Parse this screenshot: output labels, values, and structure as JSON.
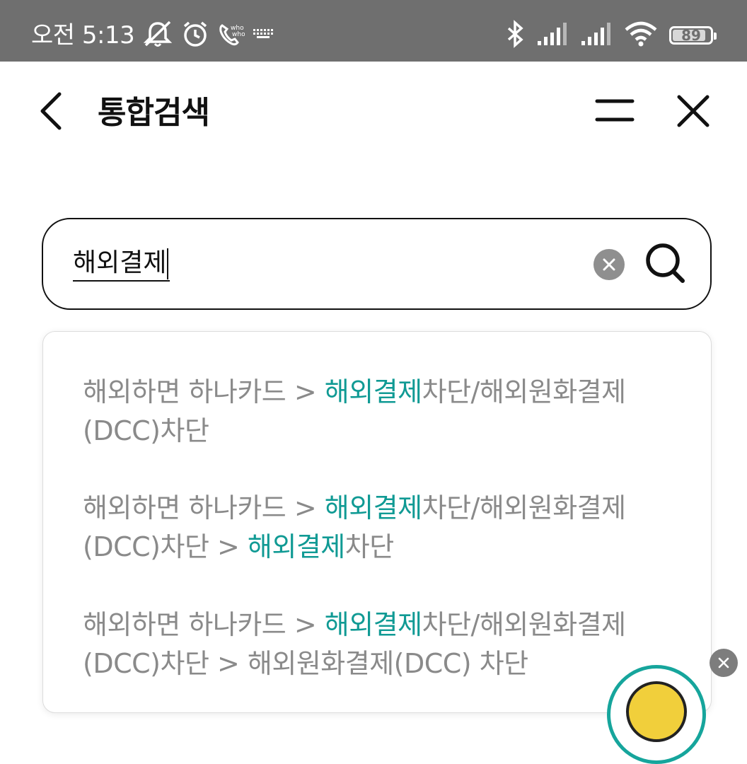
{
  "status_bar": {
    "time": "오전 5:13",
    "battery": "89",
    "battery_level": 0.89,
    "icons": [
      "mute-notification-icon",
      "alarm-icon",
      "whowho-call-icon",
      "keyboard-icon",
      "bluetooth-icon",
      "signal-icon",
      "signal-icon",
      "wifi-icon",
      "battery-icon"
    ]
  },
  "header": {
    "title": "통합검색",
    "icons": [
      "back-arrow-icon",
      "menu-icon",
      "close-icon"
    ]
  },
  "search": {
    "value": "해외결제",
    "icons": [
      "clear-icon",
      "search-icon"
    ]
  },
  "suggestions": [
    {
      "pre": "해외하면 하나카드 > ",
      "hl1": "해외결제",
      "mid": "차단/해외원화결제(DCC)차단",
      "hl2": "",
      "post": ""
    },
    {
      "pre": "해외하면 하나카드 > ",
      "hl1": "해외결제",
      "mid": "차단/해외원화결제(DCC)차단 > ",
      "hl2": "해외결제",
      "post": "차단"
    },
    {
      "pre": "해외하면 하나카드 > ",
      "hl1": "해외결제",
      "mid": "차단/해외원화결제(DCC)차단 > 해외원화결제(DCC) 차단",
      "hl2": "",
      "post": ""
    }
  ],
  "colors": {
    "status_bar_bg": "#6f6f6f",
    "highlight": "#109a94",
    "suggestion_text": "#8a8a8a",
    "chatbot_ring": "#16a59c"
  }
}
